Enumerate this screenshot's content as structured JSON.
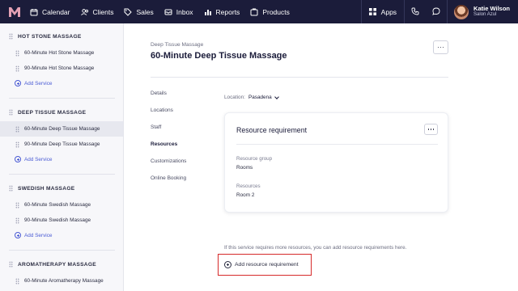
{
  "nav": {
    "items": [
      {
        "label": "Calendar",
        "icon": "calendar-icon"
      },
      {
        "label": "Clients",
        "icon": "clients-icon"
      },
      {
        "label": "Sales",
        "icon": "sales-tag-icon"
      },
      {
        "label": "Inbox",
        "icon": "inbox-icon"
      },
      {
        "label": "Reports",
        "icon": "reports-icon"
      },
      {
        "label": "Products",
        "icon": "products-icon"
      }
    ],
    "apps_label": "Apps",
    "user": {
      "name": "Katie Wilson",
      "org": "Salon Azul"
    }
  },
  "sidebar": {
    "groups": [
      {
        "title": "HOT STONE MASSAGE",
        "services": [
          "60-Minute Hot Stone Massage",
          "90-Minute Hot Stone Massage"
        ],
        "add_label": "Add Service"
      },
      {
        "title": "DEEP TISSUE MASSAGE",
        "services": [
          "60-Minute Deep Tissue Massage",
          "90-Minute Deep Tissue Massage"
        ],
        "add_label": "Add Service"
      },
      {
        "title": "SWEDISH MASSAGE",
        "services": [
          "60-Minute Swedish Massage",
          "90-Minute Swedish Massage"
        ],
        "add_label": "Add Service"
      },
      {
        "title": "AROMATHERAPY MASSAGE",
        "services": [
          "60-Minute Aromatherapy Massage"
        ]
      }
    ],
    "active_service": "60-Minute Deep Tissue Massage"
  },
  "page": {
    "breadcrumb": "Deep Tissue Massage",
    "title": "60-Minute Deep Tissue Massage"
  },
  "subnav": {
    "items": [
      "Details",
      "Locations",
      "Staff",
      "Resources",
      "Customizations",
      "Online Booking"
    ],
    "active": "Resources"
  },
  "location": {
    "label": "Location:",
    "value": "Pasadena"
  },
  "card": {
    "title": "Resource requirement",
    "group_label": "Resource group",
    "group_value": "Rooms",
    "resources_label": "Resources",
    "resources_value": "Room 2"
  },
  "helper_text": "If this service requires more resources, you can add resource requirements here.",
  "add_requirement_label": "Add resource requirement",
  "colors": {
    "topbar": "#1b1c3a",
    "accent": "#4a5bd4",
    "highlight": "#d62a2a"
  }
}
